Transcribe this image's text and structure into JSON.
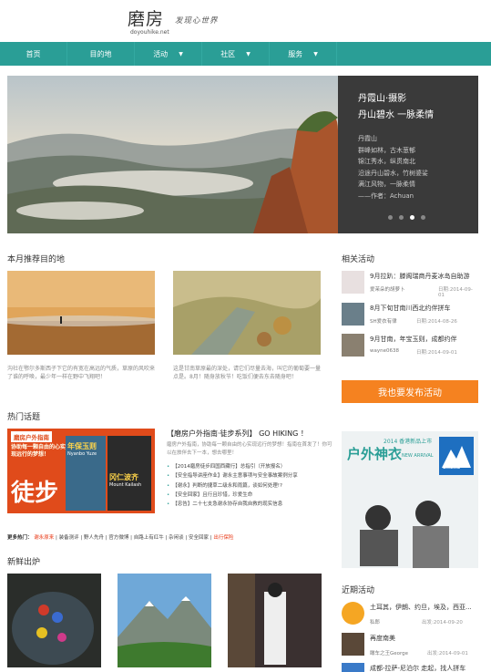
{
  "brand": {
    "name_cn": "磨房",
    "domain": "doyouhike.net",
    "slogan": "发现心世界"
  },
  "nav": [
    {
      "label": "首页",
      "dropdown": false
    },
    {
      "label": "目的地",
      "dropdown": false
    },
    {
      "label": "活动",
      "dropdown": true
    },
    {
      "label": "社区",
      "dropdown": true
    },
    {
      "label": "服务",
      "dropdown": true
    }
  ],
  "hero": {
    "title1": "丹霞山·摄影",
    "title2": "丹山碧水 一脉柔情",
    "lines": [
      "丹霞山",
      "群峰如林，古木葱郁",
      "锦江秀水，纵贯南北",
      "沿途丹山碧水，竹树婆娑",
      "满江风物，一脉柔情",
      "——作者：Achuan"
    ],
    "slides": 4,
    "active_slide": 3
  },
  "recommend": {
    "heading": "本月推荐目的地",
    "items": [
      {
        "caption": "沟社在鄂尔多斯西子下它的有宽在高远的气质，草原的风吹来了谁的呼唤，最少年一样在野中飞翔吧！"
      },
      {
        "caption": "这是甘南草原最的深处，请它们尽量去海，叫它的葡萄要一量点是。8月！随身放秋节！吃饭们便去东去随身吧！"
      }
    ]
  },
  "related": {
    "heading": "相关活动",
    "items": [
      {
        "title": "9月拉趴：滕阁瑞商丹麦冰岛自助游",
        "author": "爱茉朵的胡萝卜",
        "date": "日期:2014-09-01"
      },
      {
        "title": "8月下旬甘南川西北约伴拼车",
        "author": "SH爱衣有律",
        "date": "日期:2014-08-26"
      },
      {
        "title": "9月甘南，年宝玉则，成都约伴",
        "author": "wayne0638",
        "date": "日期:2014-09-01"
      }
    ]
  },
  "publish_button": "我也要发布活动",
  "ad": {
    "title": "户外神衣",
    "sub": "2014 香港新品上市",
    "en": "NEW ARRIVAL",
    "brand": "Shehe"
  },
  "hot": {
    "heading": "热门话题",
    "img_top": "磨房户外指南",
    "img_sub": "协助每一颗自由的心实现远行的梦想！",
    "img_big": "徒步",
    "book1": "年保玉则",
    "book1_en": "Nyanbo Yuze",
    "book2": "冈仁波齐",
    "book2_en": "Mount Kailash",
    "title": "【磨房户外指南·徒步系列】 GO HIKING ！",
    "desc": "磨房户外指南，协助每一颗自由的心实现远行的梦想！指南在首发了！你可以在旅伴去下一本，想去哪里！",
    "list": [
      "【2014磨房徒步四国西藏行】总指引（开放报名）",
      "【安全指导讲座作业】谢永主意事项与安全事故案例分享",
      "【谢永】判断的捷草二级永和雨篇，谈如何处理!?",
      "【安全回家】且行且珍惜，珍爱生命",
      "【忠告】二十七支急谢永协存自我自救的现实信息"
    ]
  },
  "more": {
    "label": "更多热门：",
    "links": [
      "谢永原来",
      "装备测评",
      "野人先舟",
      "官方微博",
      "自路上有红牛",
      "杂闲谈",
      "安全回家",
      "出行保险"
    ]
  },
  "fresh": {
    "heading": "新鲜出炉"
  },
  "recent": {
    "heading": "近期活动",
    "items": [
      {
        "title": "土耳其，伊朗、约旦，埃及，西亚...",
        "author": "私郎",
        "date": "出发:2014-09-20"
      },
      {
        "title": "再度南美",
        "author": "瞰车之王George",
        "date": "出发:2014-09-01"
      },
      {
        "title": "成都-拉萨-尼泊尔 走起，找人拼车",
        "author": "",
        "date": ""
      }
    ]
  },
  "colors": {
    "nav": "#2a9e96",
    "accent": "#f58220",
    "panel": "#3a3a3a",
    "link_red": "#e8320e"
  }
}
